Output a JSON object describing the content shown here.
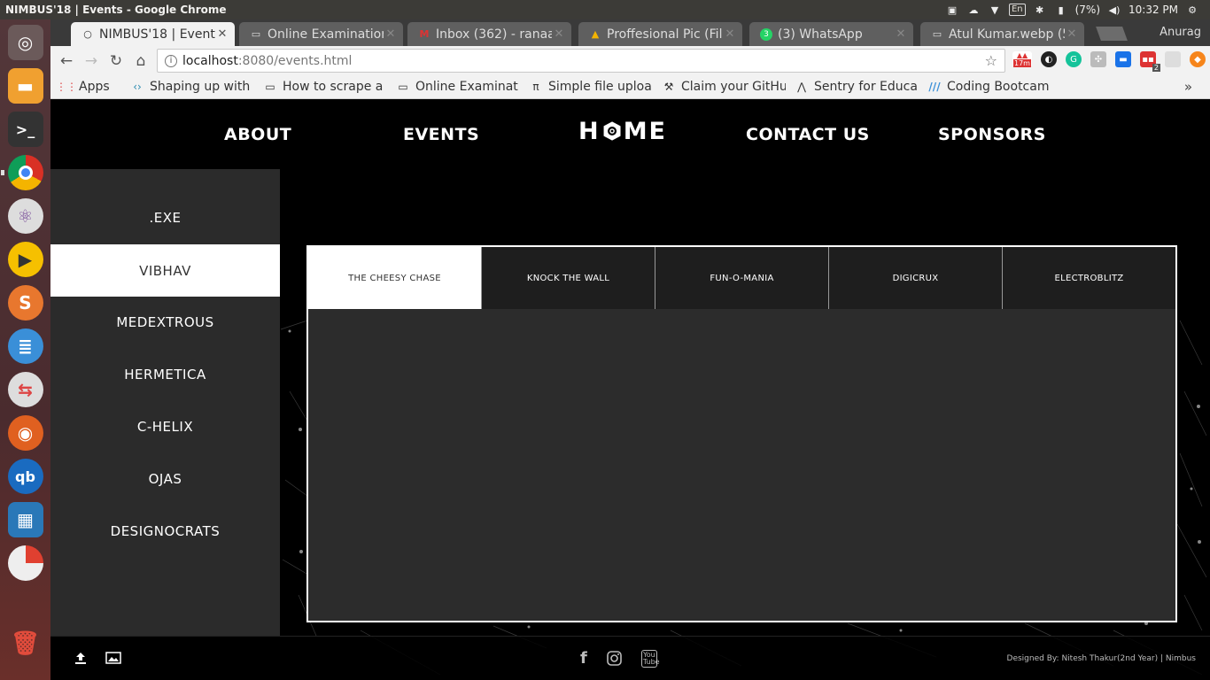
{
  "os": {
    "window_title": "NIMBUS'18 | Events - Google Chrome",
    "tray": {
      "keyboard": "En",
      "battery": "(7%)",
      "time": "10:32 PM"
    },
    "launcher": [
      "ubuntu-dash",
      "files",
      "terminal",
      "chrome",
      "atom",
      "player",
      "sublime",
      "text-editor",
      "settings",
      "firefox",
      "qbittorrent",
      "image-viewer",
      "disk-usage",
      "trash"
    ]
  },
  "browser": {
    "tabs": [
      {
        "label": "NIMBUS'18 | Events",
        "icon": "page-icon",
        "active": true
      },
      {
        "label": "Online Examination",
        "icon": "doc-icon",
        "active": false
      },
      {
        "label": "Inbox (362) - ranaan",
        "icon": "gmail-icon",
        "active": false
      },
      {
        "label": "Proffesional Pic (File",
        "icon": "drive-icon",
        "active": false
      },
      {
        "label": "(3) WhatsApp",
        "icon": "whatsapp-icon",
        "active": false
      },
      {
        "label": "Atul Kumar.webp (5",
        "icon": "doc-icon",
        "active": false
      }
    ],
    "profile": "Anurag",
    "address": {
      "host": "localhost",
      "path": ":8080/events.html"
    },
    "ext_badges": {
      "time": "17m",
      "count": "2"
    },
    "bookmarks": [
      {
        "label": "Apps",
        "icon": "apps-icon"
      },
      {
        "label": "Shaping up with",
        "icon": "code-icon"
      },
      {
        "label": "How to scrape a",
        "icon": "doc-icon"
      },
      {
        "label": "Online Examinat",
        "icon": "doc-icon"
      },
      {
        "label": "Simple file uploa",
        "icon": "pi-icon"
      },
      {
        "label": "Claim your GitHu",
        "icon": "tools-icon"
      },
      {
        "label": "Sentry for Educa",
        "icon": "sentry-icon"
      },
      {
        "label": "Coding Bootcam",
        "icon": "bootcamp-icon"
      }
    ],
    "bookmarks_more": "»"
  },
  "site": {
    "nav": {
      "about": "ABOUT",
      "events": "EVENTS",
      "contact": "CONTACT US",
      "sponsors": "SPONSORS"
    },
    "logo": {
      "left": "H",
      "right": "ME"
    },
    "categories": [
      ".EXE",
      "VIBHAV",
      "MEDEXTROUS",
      "HERMETICA",
      "C-HELIX",
      "OJAS",
      "DESIGNOCRATS"
    ],
    "active_category": "VIBHAV",
    "event_tabs": [
      "THE CHEESY CHASE",
      "KNOCK THE WALL",
      "FUN-O-MANIA",
      "DIGICRUX",
      "ELECTROBLITZ"
    ],
    "active_event": "THE CHEESY CHASE",
    "footer": {
      "credit": "Designed By: Nitesh Thakur(2nd Year) | Nimbus",
      "youtube": "You Tube"
    }
  }
}
